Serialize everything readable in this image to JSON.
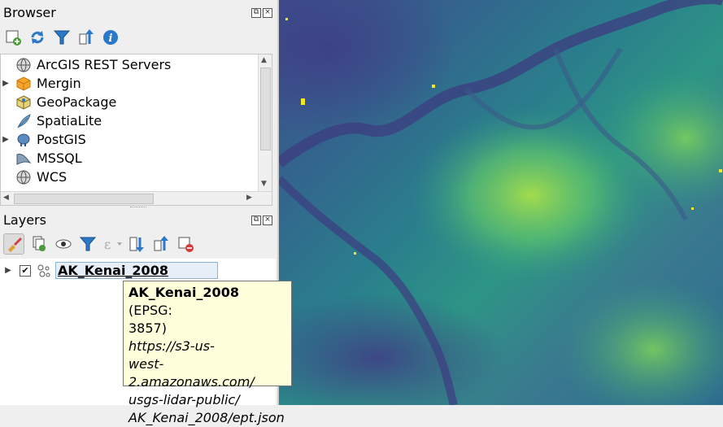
{
  "browser": {
    "title": "Browser",
    "toolbar": [
      {
        "name": "add-selected-layers-icon",
        "color": "#4a9b3c"
      },
      {
        "name": "refresh-icon",
        "color": "#2a79c9"
      },
      {
        "name": "filter-icon",
        "color": "#2a79c9"
      },
      {
        "name": "collapse-all-icon",
        "color": "#2a79c9"
      },
      {
        "name": "info-icon",
        "color": "#2a79c9"
      }
    ],
    "items": [
      {
        "label": "ArcGIS REST Servers",
        "icon": "globe-icon",
        "expandable": false
      },
      {
        "label": "Mergin",
        "icon": "mergin-cube-icon",
        "expandable": true
      },
      {
        "label": "GeoPackage",
        "icon": "geopackage-icon",
        "expandable": false
      },
      {
        "label": "SpatiaLite",
        "icon": "feather-icon",
        "expandable": false
      },
      {
        "label": "PostGIS",
        "icon": "elephant-icon",
        "expandable": true
      },
      {
        "label": "MSSQL",
        "icon": "mssql-icon",
        "expandable": false
      },
      {
        "label": "WCS",
        "icon": "globe-icon",
        "expandable": false
      }
    ]
  },
  "layers": {
    "title": "Layers",
    "layer": {
      "name": "AK_Kenai_2008",
      "checked": true
    }
  },
  "tooltip": {
    "name": "AK_Kenai_2008",
    "crs_a": " (EPSG:",
    "crs_b": "3857)",
    "url1": "https://s3-us-",
    "url2": "west-2.amazonaws.com/",
    "url3": "usgs-lidar-public/",
    "url4": "AK_Kenai_2008/ept.json"
  },
  "colors": {
    "accent": "#2a79c9",
    "tooltip_bg": "#ffffdc",
    "raster_low": "#3e3f86",
    "raster_high": "#a8e04a"
  }
}
